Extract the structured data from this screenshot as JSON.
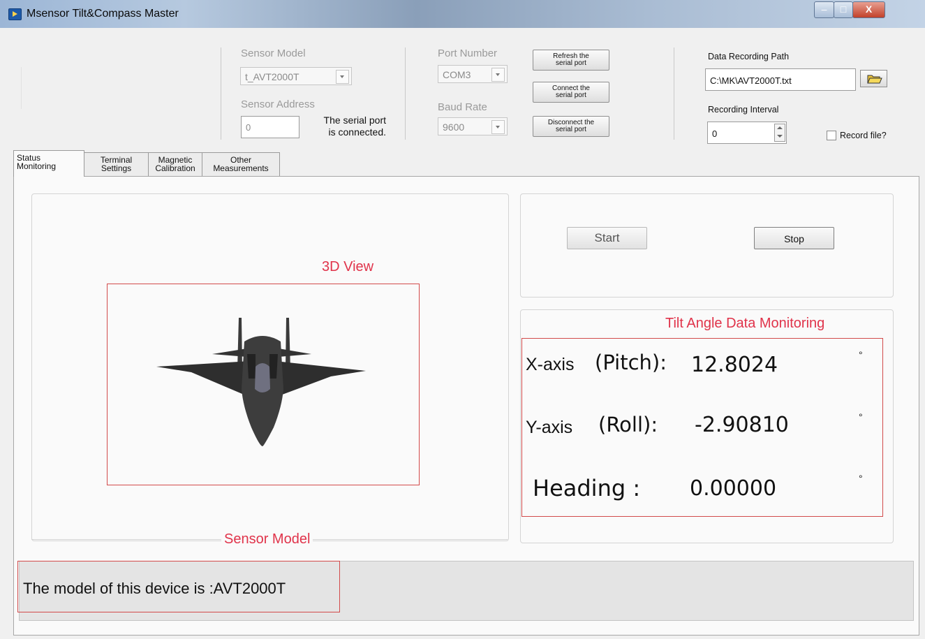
{
  "window": {
    "title": "Msensor Tilt&Compass Master",
    "minimize": "–",
    "maximize": "□",
    "close": "X"
  },
  "sensor": {
    "model_label": "Sensor Model",
    "model_value": "t_AVT2000T",
    "address_label": "Sensor Address",
    "address_value": "0",
    "status_line1": "The serial port",
    "status_line2": "is connected."
  },
  "port": {
    "number_label": "Port Number",
    "number_value": "COM3",
    "baud_label": "Baud Rate",
    "baud_value": "9600",
    "refresh_line1": "Refresh the",
    "refresh_line2": "serial port",
    "connect_line1": "Connect the",
    "connect_line2": "serial port",
    "disconnect_line1": "Disconnect the",
    "disconnect_line2": "serial port"
  },
  "recording": {
    "path_label": "Data Recording Path",
    "path_value": "C:\\MK\\AVT2000T.txt",
    "interval_label": "Recording Interval",
    "interval_value": "0",
    "record_file_label": "Record file?",
    "record_file_checked": false
  },
  "tabs": [
    {
      "line1": "Status",
      "line2": "Monitoring"
    },
    {
      "line1": "Terminal",
      "line2": "Settings"
    },
    {
      "line1": "Magnetic",
      "line2": "Calibration"
    },
    {
      "line1": "Other",
      "line2": "Measurements"
    }
  ],
  "view3d": {
    "label": "3D View"
  },
  "controls": {
    "start": "Start",
    "stop": "Stop"
  },
  "monitoring": {
    "title": "Tilt Angle Data Monitoring",
    "x_label": "X-axis",
    "x_sub": "(Pitch):",
    "x_value": "12.8024",
    "y_label": "Y-axis",
    "y_sub": "(Roll):",
    "y_value": "-2.90810",
    "heading_label": "Heading :",
    "heading_value": "0.00000",
    "unit": "°"
  },
  "model_panel": {
    "label": "Sensor Model",
    "text": "The model of this device is :AVT2000T"
  },
  "colors": {
    "annotation_red": "#e0334a",
    "box_red": "#d24a4a"
  }
}
